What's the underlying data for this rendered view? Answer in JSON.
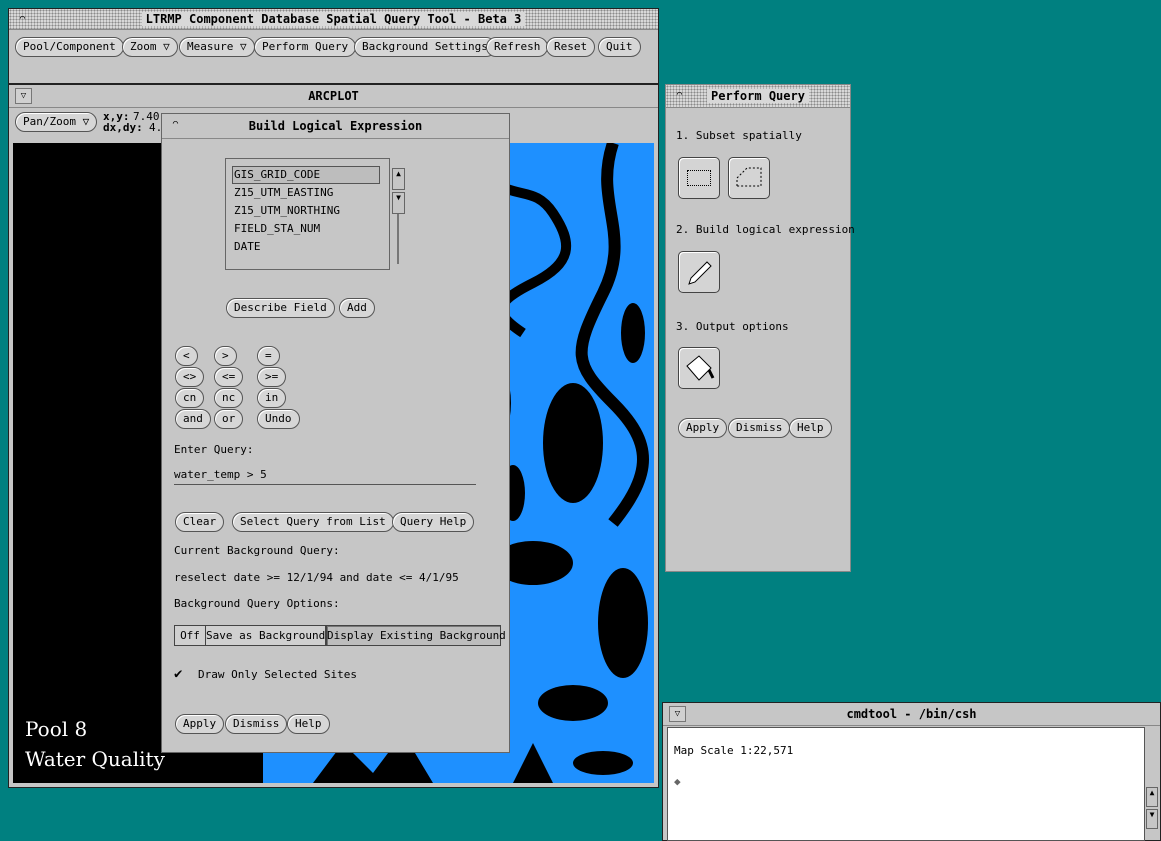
{
  "main_window": {
    "title": "LTRMP Component Database Spatial Query Tool - Beta 3",
    "menu": [
      "Pool/Component",
      "Zoom ▽",
      "Measure ▽",
      "Perform Query",
      "Background Settings",
      "Refresh",
      "Reset",
      "Quit"
    ]
  },
  "arcplot": {
    "title": "ARCPLOT",
    "panzoom": "Pan/Zoom ▽",
    "xy_label": "x,y:",
    "xy_value": "7.40",
    "dxdy_label": "dx,dy:",
    "dxdy_value": "4.",
    "map_title_1": "Pool 8",
    "map_title_2": "Water Quality",
    "colors": {
      "water": "#1e90ff",
      "land": "#000000"
    }
  },
  "ble": {
    "title": "Build Logical Expression",
    "fields": [
      "GIS_GRID_CODE",
      "Z15_UTM_EASTING",
      "Z15_UTM_NORTHING",
      "FIELD_STA_NUM",
      "DATE"
    ],
    "describe_button": "Describe Field",
    "add_button": "Add",
    "operators": [
      "<",
      ">",
      "=",
      "<>",
      "<=",
      ">=",
      "cn",
      "nc",
      "in",
      "and",
      "or",
      "Undo"
    ],
    "enter_query_label": "Enter Query:",
    "query_value": "water_temp > 5",
    "clear_button": "Clear",
    "select_query_button": "Select Query from List",
    "query_help_button": "Query Help",
    "current_bg_label": "Current Background Query:",
    "current_bg_value": "reselect date >= 12/1/94 and date <= 4/1/95",
    "bg_options_label": "Background Query Options:",
    "bg_options": [
      "Off",
      "Save as Background",
      "Display Existing Background"
    ],
    "draw_only_label": "Draw Only Selected Sites",
    "apply": "Apply",
    "dismiss": "Dismiss",
    "help": "Help"
  },
  "perform_query": {
    "title": "Perform Query",
    "step1": "1. Subset spatially",
    "step2": "2. Build logical expression",
    "step3": "3. Output options",
    "apply": "Apply",
    "dismiss": "Dismiss",
    "help": "Help"
  },
  "cmdtool": {
    "title": "cmdtool - /bin/csh",
    "line1": "Map Scale 1:22,571",
    "prompt": "◆"
  }
}
